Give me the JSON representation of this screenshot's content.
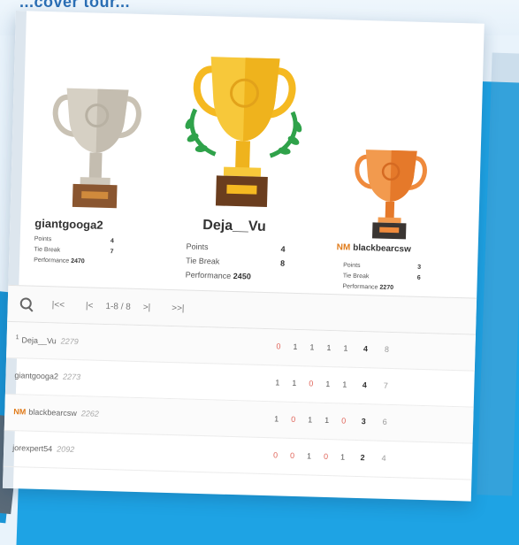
{
  "caption": "...cover tour...",
  "podium": {
    "first": {
      "name": "Deja__Vu",
      "stats": [
        {
          "label": "Points",
          "value": "4"
        },
        {
          "label": "Tie Break",
          "value": "8"
        },
        {
          "label": "Performance",
          "value": "2450"
        }
      ]
    },
    "second": {
      "name": "giantgooga2",
      "stats": [
        {
          "label": "Points",
          "value": "4"
        },
        {
          "label": "Tie Break",
          "value": "7"
        },
        {
          "label": "Performance",
          "value": "2470"
        }
      ]
    },
    "third": {
      "title": "NM",
      "name": "blackbearcsw",
      "stats": [
        {
          "label": "Points",
          "value": "3"
        },
        {
          "label": "Tie Break",
          "value": "6"
        },
        {
          "label": "Performance",
          "value": "2270"
        }
      ]
    }
  },
  "toolbar": {
    "first": "|<<",
    "prev": "|<",
    "range": "1-8 / 8",
    "next": ">|",
    "last": ">>|"
  },
  "rows": [
    {
      "rank": "1",
      "title": "",
      "name": "Deja__Vu",
      "rating": "2279",
      "scores": [
        "0",
        "1",
        "1",
        "1",
        "1"
      ],
      "total": "4",
      "tb": "8"
    },
    {
      "rank": "",
      "title": "",
      "name": "giantgooga2",
      "rating": "2273",
      "scores": [
        "1",
        "1",
        "0",
        "1",
        "1"
      ],
      "total": "4",
      "tb": "7"
    },
    {
      "rank": "",
      "title": "NM",
      "name": "blackbearcsw",
      "rating": "2262",
      "scores": [
        "1",
        "0",
        "1",
        "1",
        "0"
      ],
      "total": "3",
      "tb": "6"
    },
    {
      "rank": "",
      "title": "",
      "name": "jorexpert54",
      "rating": "2092",
      "scores": [
        "0",
        "0",
        "1",
        "0",
        "1"
      ],
      "total": "2",
      "tb": "4"
    }
  ],
  "colors": {
    "accent_blue": "#1ea3e4",
    "gold": "#f5b921",
    "silver": "#c9c2b4",
    "bronze": "#ef8a3c",
    "laurel": "#2fa24a",
    "title_badge": "#e07b1a"
  }
}
